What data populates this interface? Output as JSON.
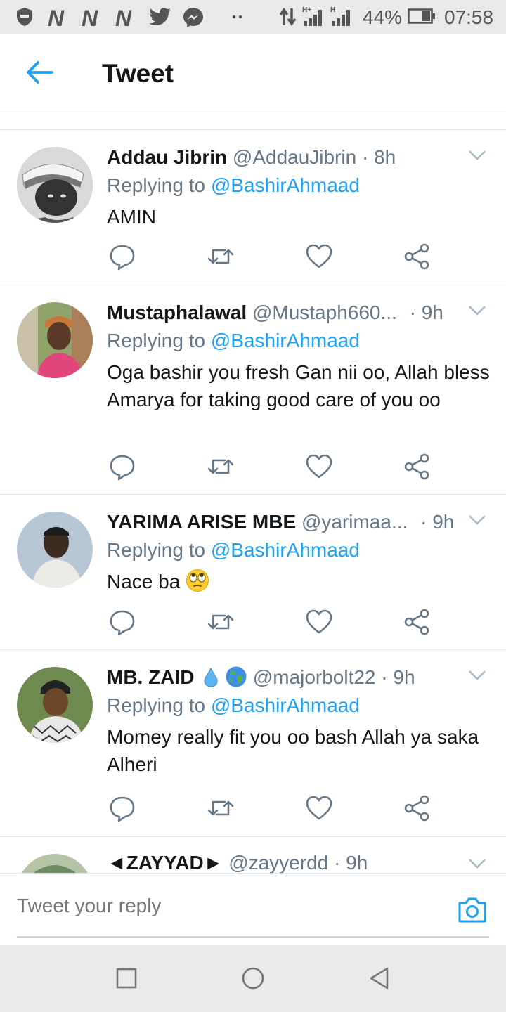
{
  "status_bar": {
    "battery_percent": "44%",
    "time": "07:58",
    "notification_letters": [
      "N",
      "N",
      "N"
    ],
    "icons": [
      "shield-icon",
      "twitter-icon",
      "messenger-icon",
      "more-dots-icon",
      "data-arrows-icon",
      "signal-h-plus-icon",
      "signal-h-icon",
      "battery-icon"
    ]
  },
  "header": {
    "title": "Tweet",
    "back_icon": "arrow-left-icon"
  },
  "colors": {
    "accent": "#1da1f2",
    "secondary_text": "#657786",
    "divider": "#e1e8ed"
  },
  "tweets": [
    {
      "name": "Addau Jibrin",
      "handle": "@AddauJibrin",
      "dot": "·",
      "time": "8h",
      "replying_prefix": "Replying to ",
      "replying_to": "@BashirAhmaad",
      "body": "AMIN"
    },
    {
      "name": "Mustaphalawal",
      "handle": "@Mustaph660...",
      "dot": "·",
      "time": "9h",
      "replying_prefix": "Replying to ",
      "replying_to": "@BashirAhmaad",
      "body": "Oga bashir you fresh Gan nii oo, Allah bless Amarya for taking good care of you oo"
    },
    {
      "name": "YARIMA ARISE MBE",
      "handle": "@yarimaa...",
      "dot": "·",
      "time": "9h",
      "replying_prefix": "Replying to ",
      "replying_to": "@BashirAhmaad",
      "body": "Nace ba",
      "emoji": "face-with-rolling-eyes"
    },
    {
      "name": "MB. ZAID",
      "name_emojis": [
        "droplet",
        "globe"
      ],
      "handle": "@majorbolt22",
      "dot": "·",
      "time": "9h",
      "replying_prefix": "Replying to ",
      "replying_to": "@BashirAhmaad",
      "body": "Momey really fit you oo bash Allah ya saka Alheri"
    },
    {
      "name": "◄ZAYYAD►",
      "handle": "@zayyerdd",
      "dot": "·",
      "time": "9h"
    }
  ],
  "reply_bar": {
    "placeholder": "Tweet your reply",
    "camera_icon": "camera-icon"
  },
  "nav_bar": {
    "icons": [
      "recent-apps-icon",
      "home-icon",
      "back-triangle-icon"
    ]
  }
}
